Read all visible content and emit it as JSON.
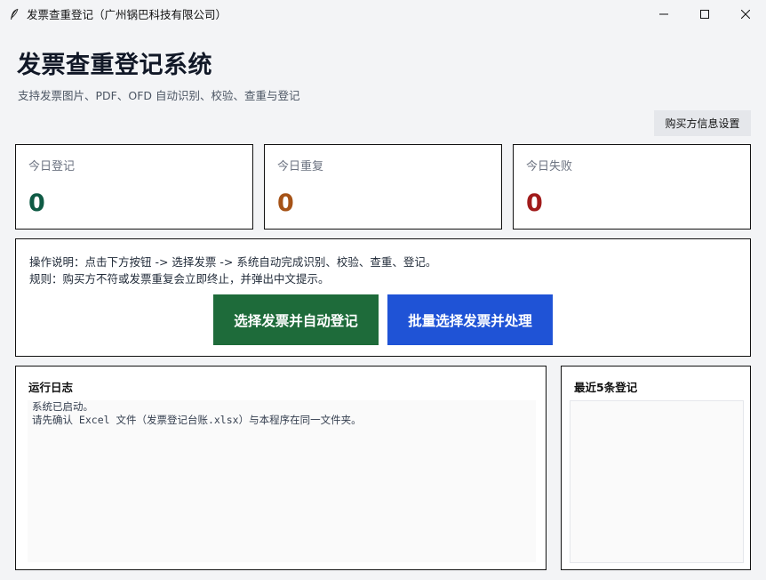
{
  "window": {
    "title": "发票查重登记（广州锅巴科技有限公司）",
    "controls": [
      "minimize-icon",
      "maximize-icon",
      "close-icon"
    ]
  },
  "header": {
    "title": "发票查重登记系统",
    "subtitle": "支持发票图片、PDF、OFD 自动识别、校验、查重与登记",
    "buyer_settings_label": "购买方信息设置"
  },
  "stats": [
    {
      "label": "今日登记",
      "value": "0",
      "color": "#0f5b45"
    },
    {
      "label": "今日重复",
      "value": "0",
      "color": "#a65317"
    },
    {
      "label": "今日失败",
      "value": "0",
      "color": "#a11b1b"
    }
  ],
  "instructions": {
    "line1": "操作说明：点击下方按钮 -> 选择发票 -> 系统自动完成识别、校验、查重、登记。",
    "line2": "规则：购买方不符或发票重复会立即终止，并弹出中文提示。",
    "auto_register_label": "选择发票并自动登记",
    "auto_register_color": "#1e6b3a",
    "batch_label": "批量选择发票并处理",
    "batch_color": "#1f53d6"
  },
  "log": {
    "heading": "运行日志",
    "lines": [
      "系统已启动。",
      "请先确认 Excel 文件（发票登记台账.xlsx）与本程序在同一文件夹。"
    ]
  },
  "recent": {
    "heading": "最近5条登记",
    "items": []
  }
}
